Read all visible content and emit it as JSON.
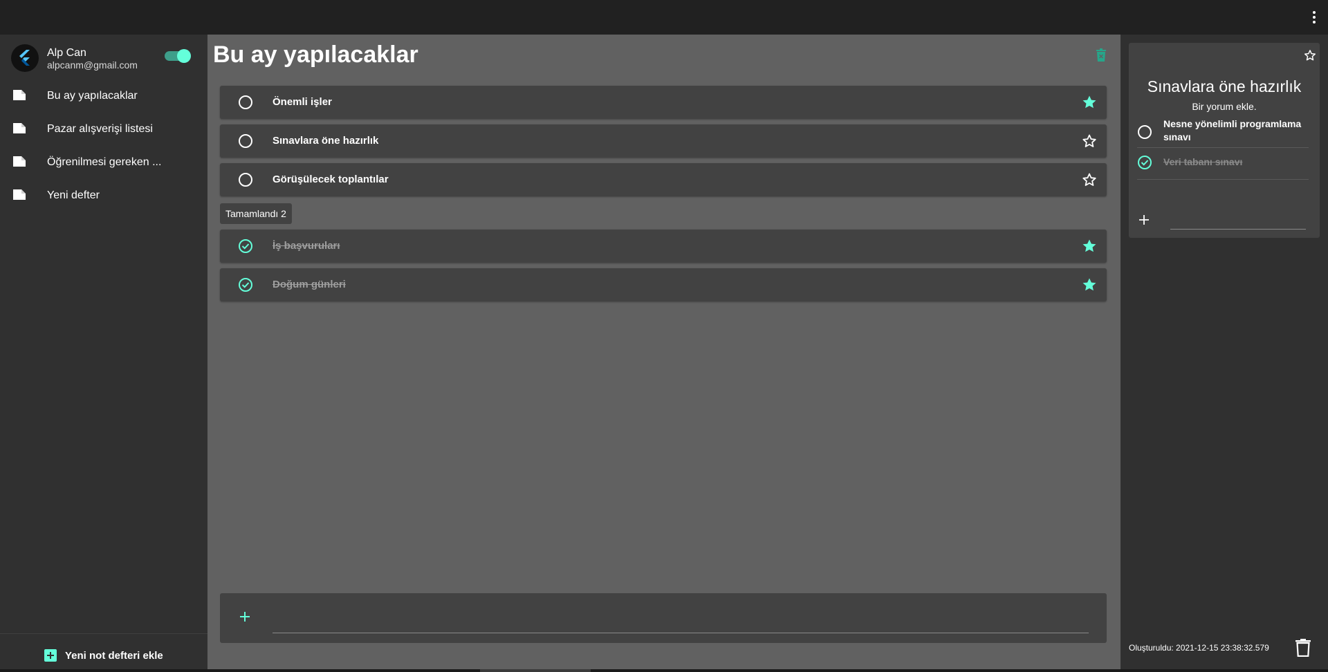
{
  "user": {
    "name": "Alp Can",
    "email": "alpcanm@gmail.com",
    "dark_mode": true
  },
  "sidebar": {
    "items": [
      {
        "label": "Bu ay yapılacaklar"
      },
      {
        "label": "Pazar alışverişi listesi"
      },
      {
        "label": "Öğrenilmesi gereken ..."
      },
      {
        "label": "Yeni defter"
      }
    ],
    "add_label": "Yeni not defteri ekle"
  },
  "main": {
    "title": "Bu ay yapılacaklar",
    "tasks": [
      {
        "label": "Önemli işler",
        "done": false,
        "starred": true
      },
      {
        "label": "Sınavlara öne hazırlık",
        "done": false,
        "starred": false
      },
      {
        "label": "Görüşülecek toplantılar",
        "done": false,
        "starred": false
      }
    ],
    "completed_label": "Tamamlandı 2",
    "completed_tasks": [
      {
        "label": "İş başvuruları",
        "done": true,
        "starred": true
      },
      {
        "label": "Doğum günleri",
        "done": true,
        "starred": true
      }
    ],
    "new_task_placeholder": ""
  },
  "detail": {
    "title": "Sınavlara öne hazırlık",
    "comment": "Bir yorum ekle.",
    "starred": false,
    "subtasks": [
      {
        "label": "Nesne yönelimli programlama sınavı",
        "done": false
      },
      {
        "label": "Veri tabanı sınavı",
        "done": true
      }
    ],
    "created": "Oluşturuldu: 2021-12-15 23:38:32.579"
  },
  "colors": {
    "accent": "#64ffda",
    "main_bg": "#616161",
    "card_bg": "#424242",
    "sidebar_bg": "#303030",
    "topbar_bg": "#212121"
  }
}
